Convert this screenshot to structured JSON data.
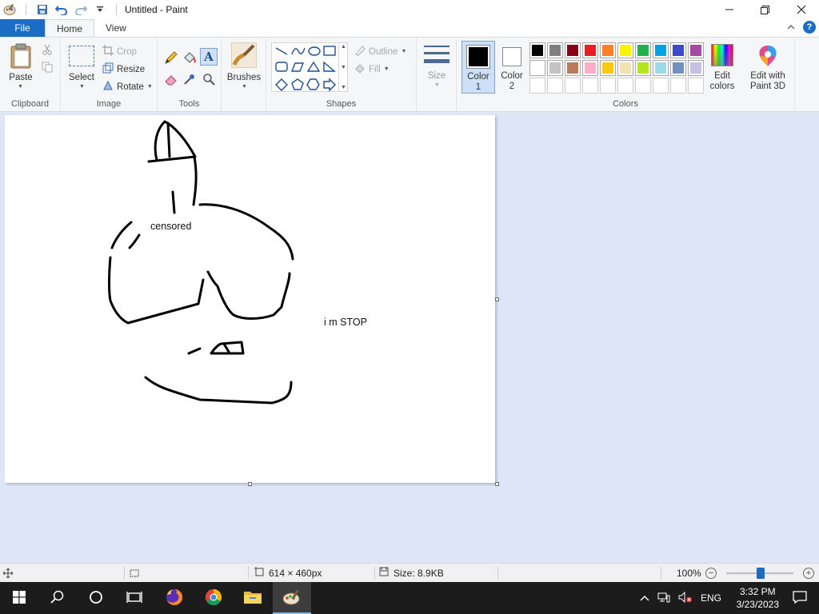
{
  "window": {
    "title": "Untitled - Paint"
  },
  "tabs": {
    "file": "File",
    "home": "Home",
    "view": "View"
  },
  "ribbon": {
    "clipboard": {
      "paste": "Paste",
      "label": "Clipboard"
    },
    "image": {
      "select": "Select",
      "crop": "Crop",
      "resize": "Resize",
      "rotate": "Rotate",
      "label": "Image"
    },
    "tools": {
      "label": "Tools"
    },
    "brushes": {
      "label": "Brushes"
    },
    "shapes": {
      "outline": "Outline",
      "fill": "Fill",
      "label": "Shapes"
    },
    "size": {
      "label": "Size"
    },
    "colors": {
      "color1": "Color",
      "color1_num": "1",
      "color2": "Color",
      "color2_num": "2",
      "edit_colors_1": "Edit",
      "edit_colors_2": "colors",
      "paint3d_1": "Edit with",
      "paint3d_2": "Paint 3D",
      "label": "Colors",
      "color1_value": "#000000",
      "color2_value": "#ffffff",
      "palette": [
        "#000000",
        "#7f7f7f",
        "#880015",
        "#ed1c24",
        "#ff7f27",
        "#fff200",
        "#22b14c",
        "#00a2e8",
        "#3f48cc",
        "#a349a4",
        "#ffffff",
        "#c3c3c3",
        "#b97a57",
        "#ffaec9",
        "#ffc90e",
        "#efe4b0",
        "#b5e61d",
        "#99d9ea",
        "#7092be",
        "#c8bfe7",
        "#ffffff",
        "#ffffff",
        "#ffffff",
        "#ffffff",
        "#ffffff",
        "#ffffff",
        "#ffffff",
        "#ffffff",
        "#ffffff",
        "#ffffff"
      ]
    }
  },
  "canvas": {
    "text_censored": "censored",
    "text_stop": "i m STOP"
  },
  "status": {
    "dimensions": "614 × 460px",
    "size": "Size: 8.9KB",
    "zoom": "100%"
  },
  "taskbar": {
    "lang": "ENG",
    "time": "3:32 PM",
    "date": "3/23/2023"
  }
}
